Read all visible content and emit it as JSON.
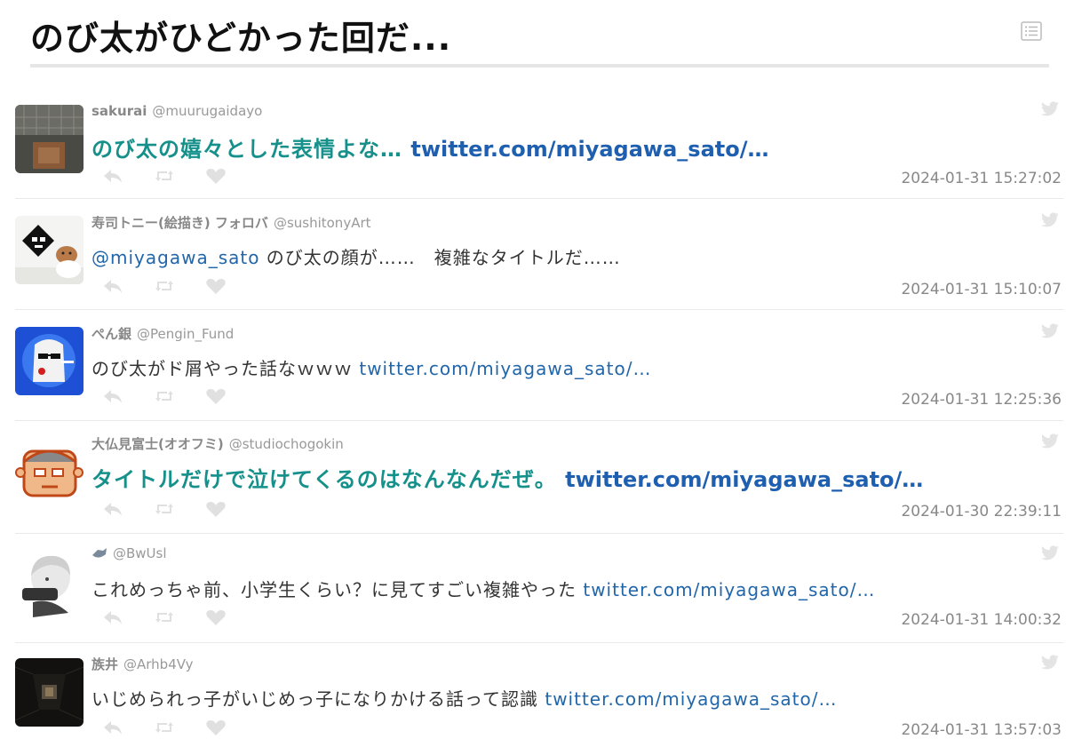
{
  "page": {
    "title": "のび太がひどかった回だ..."
  },
  "icons": {
    "list": "list-icon",
    "reply": "reply-icon",
    "retweet": "retweet-icon",
    "like": "heart-icon",
    "bird": "twitter-bird-icon"
  },
  "colors": {
    "accent_teal": "#16908a",
    "link_blue": "#2266aa",
    "icon_gray": "#e0e0e0",
    "meta_gray": "#888888"
  },
  "tweets": [
    {
      "name": "sakurai",
      "handle": "@muurugaidayo",
      "mention": "",
      "text": "のび太の嬉々とした表情よな… ",
      "link": "twitter.com/miyagawa_sato/…",
      "date": "2024-01-31 15:27:02",
      "style": "big"
    },
    {
      "name": "寿司トニー(絵描き) フォロバ",
      "handle": "@sushitonyArt",
      "mention": "@miyagawa_sato",
      "text": " のび太の顔が……　複雑なタイトルだ……",
      "link": "",
      "date": "2024-01-31 15:10:07",
      "style": "normal"
    },
    {
      "name": "ぺん銀",
      "handle": "@Pengin_Fund",
      "mention": "",
      "text": "のび太がド屑やった話なｗｗｗ ",
      "link": "twitter.com/miyagawa_sato/…",
      "date": "2024-01-31 12:25:36",
      "style": "normal"
    },
    {
      "name": "大仏見富士(オオフミ)",
      "handle": "@studiochogokin",
      "mention": "",
      "text": "タイトルだけで泣けてくるのはなんなんだぜ。 ",
      "link": "twitter.com/miyagawa_sato/…",
      "date": "2024-01-30 22:39:11",
      "style": "big"
    },
    {
      "name": "",
      "handle": "@BwUsl",
      "mention": "",
      "text": "これめっちゃ前、小学生くらい？に見てすごい複雑やった ",
      "link": "twitter.com/miyagawa_sato/…",
      "date": "2024-01-31 14:00:32",
      "style": "normal"
    },
    {
      "name": "族井",
      "handle": "@Arhb4Vy",
      "mention": "",
      "text": "いじめられっ子がいじめっ子になりかける話って認識 ",
      "link": "twitter.com/miyagawa_sato/…",
      "date": "2024-01-31 13:57:03",
      "style": "normal"
    }
  ]
}
